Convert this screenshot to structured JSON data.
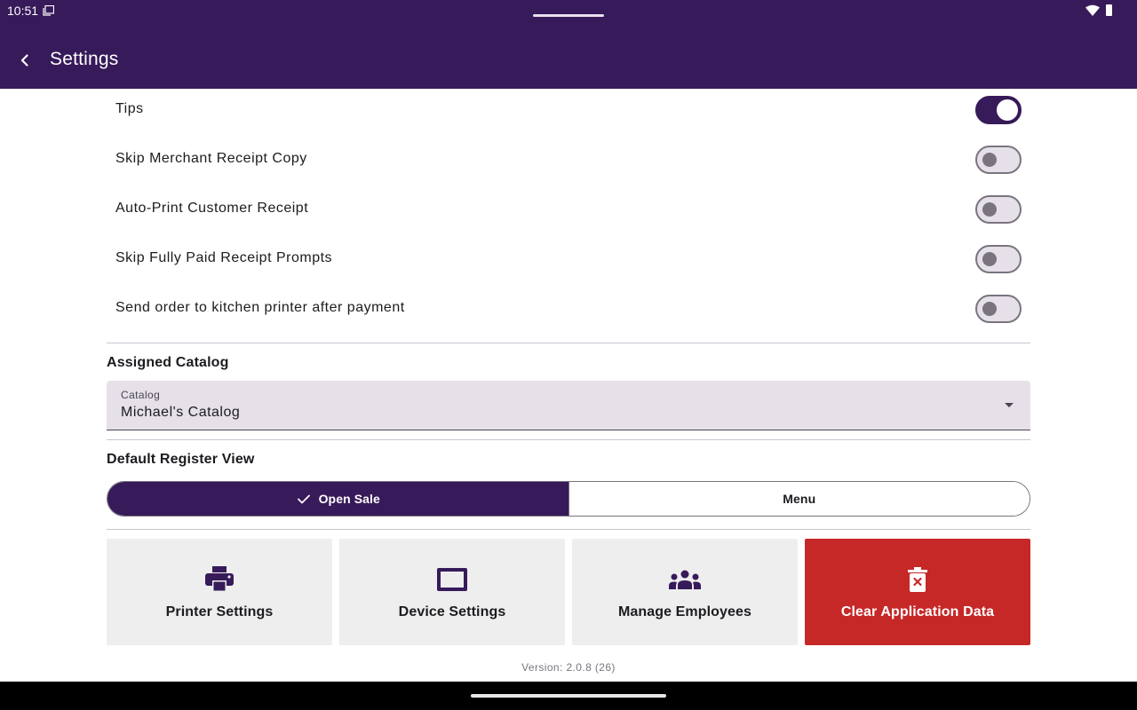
{
  "status_bar": {
    "time": "10:51",
    "icons": [
      "notification-icon",
      "wifi-icon",
      "battery-icon"
    ]
  },
  "app_bar": {
    "title": "Settings",
    "back_icon": "chevron-left-icon",
    "background": "#371a59"
  },
  "toggles": [
    {
      "label": "Tips",
      "on": true
    },
    {
      "label": "Skip Merchant Receipt Copy",
      "on": false
    },
    {
      "label": "Auto-Print Customer Receipt",
      "on": false
    },
    {
      "label": "Skip Fully Paid Receipt Prompts",
      "on": false
    },
    {
      "label": "Send order to kitchen printer after payment",
      "on": false
    }
  ],
  "assigned_catalog": {
    "heading": "Assigned Catalog",
    "field_label": "Catalog",
    "value": "Michael's Catalog"
  },
  "default_register_view": {
    "heading": "Default Register View",
    "options": [
      {
        "label": "Open Sale",
        "selected": true
      },
      {
        "label": "Menu",
        "selected": false
      }
    ]
  },
  "actions": [
    {
      "label": "Printer Settings",
      "icon": "printer-icon"
    },
    {
      "label": "Device Settings",
      "icon": "tablet-icon"
    },
    {
      "label": "Manage Employees",
      "icon": "group-icon"
    },
    {
      "label": "Clear Application Data",
      "icon": "delete-icon",
      "danger": true
    }
  ],
  "version": "Version: 2.0.8 (26)",
  "colors": {
    "primary": "#371a59",
    "danger": "#c62828",
    "tile_background": "#eeeeee"
  }
}
